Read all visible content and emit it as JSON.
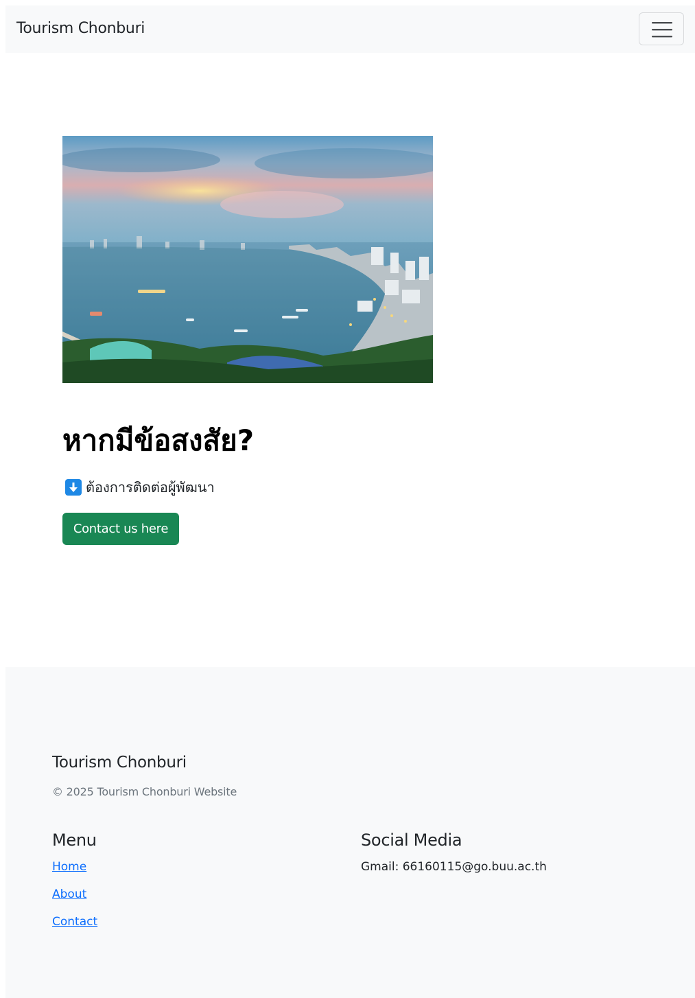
{
  "navbar": {
    "brand": "Tourism Chonburi",
    "toggler_icon": "hamburger-icon"
  },
  "hero": {
    "image_alt": "Pattaya bay at dusk",
    "heading": "หากมีข้อสงสัย?",
    "subline_icon": "arrow-down-icon",
    "subline": "ต้องการติดต่อผู้พัฒนา",
    "button_label": "Contact us here"
  },
  "footer": {
    "brand": "Tourism Chonburi",
    "copyright": "© 2025 Tourism Chonburi Website",
    "menu": {
      "title": "Menu",
      "links": [
        "Home",
        "About",
        "Contact"
      ]
    },
    "social": {
      "title": "Social Media",
      "gmail": "Gmail: 66160115@go.buu.ac.th"
    }
  },
  "colors": {
    "button": "#198754",
    "link": "#0d6efd",
    "navbar_bg": "#f8f9fa",
    "icon_blue": "#1e88e5"
  }
}
